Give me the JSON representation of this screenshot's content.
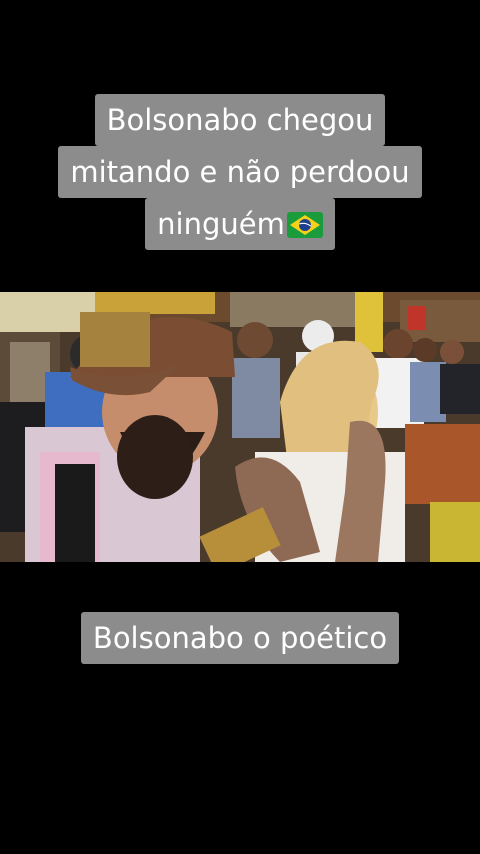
{
  "top_caption": {
    "lines": [
      "Bolsonabo chegou",
      "mitando e não perdoou",
      "ninguém"
    ],
    "emoji_icon": "brazil-flag-icon"
  },
  "bottom_caption": {
    "text": "Bolsonabo o poético"
  },
  "colors": {
    "background": "#000000",
    "caption_bg": "#8c8c8c",
    "caption_text": "#ffffff"
  }
}
